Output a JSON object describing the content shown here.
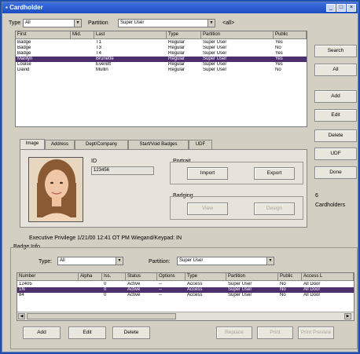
{
  "title": "Cardholder",
  "filter": {
    "type_label": "Type",
    "type_value": "All",
    "partition_label": "Partition",
    "partition_value": "Super User",
    "wildcard": "<all>"
  },
  "cardholders": {
    "columns": [
      "First",
      "Mid.",
      "Last",
      "Type",
      "Partition",
      "Public"
    ],
    "rows": [
      [
        "Badge",
        "",
        "T1",
        "Regular",
        "Super User",
        "Yes"
      ],
      [
        "Badge",
        "",
        "T3",
        "Regular",
        "Super User",
        "No"
      ],
      [
        "Badge",
        "",
        "T4",
        "Regular",
        "Super User",
        "Yes"
      ],
      [
        "Marilyn",
        "",
        "Brunette",
        "Regular",
        "Super User",
        "Yes"
      ],
      [
        "Louise",
        "",
        "Everett",
        "Regular",
        "Super User",
        "Yes"
      ],
      [
        "David",
        "",
        "Mullin",
        "Regular",
        "Super User",
        "No"
      ]
    ],
    "selected_row": 3
  },
  "side_buttons": {
    "search": "Search",
    "all": "All",
    "add": "Add",
    "edit": "Edit",
    "delete": "Delete",
    "udf": "UDF",
    "done": "Done"
  },
  "count_text": {
    "number": "6",
    "label": "Cardholders"
  },
  "tabs": [
    "Image",
    "Address",
    "Dept/Company",
    "Start/Void Badges",
    "UDF"
  ],
  "image_tab": {
    "id_label": "ID",
    "id_value": "123456",
    "portrait_label": "Portrait",
    "import_button": "Import",
    "export_button": "Export",
    "badging_label": "Badging",
    "view_button": "View",
    "design_button": "Design"
  },
  "exec_text": "Executive Privilege 1/21/00 12:41 OT PM Wiegand/Keypad: IN",
  "badge_info": {
    "title": "Badge Info",
    "type_label": "Type:",
    "type_value": "All",
    "partition_label": "Partition:",
    "partition_value": "Super User",
    "columns": [
      "Number",
      "Alpha",
      "Iss.",
      "Status",
      "Options",
      "Type",
      "Partition",
      "Public",
      "Access L"
    ],
    "rows": [
      [
        "12405",
        "",
        "0",
        "Active",
        "--",
        "Access",
        "Super User",
        "No",
        "All Door"
      ],
      [
        "1N",
        "",
        "0",
        "Active",
        "--",
        "Access",
        "Super User",
        "No",
        "All Door"
      ],
      [
        "84",
        "",
        "0",
        "Active",
        "--",
        "Access",
        "Super User",
        "No",
        "All Door"
      ]
    ],
    "selected_row": 1
  },
  "bottom_buttons": {
    "add": "Add",
    "edit": "Edit",
    "delete": "Delete",
    "replace": "Replace",
    "print": "Print",
    "preview": "Print Preview"
  },
  "colors": {
    "desktop": "#1d4fb3",
    "titlebar": "#2456cc",
    "selection": "#4d2f6e",
    "window": "#d4cfc3"
  }
}
